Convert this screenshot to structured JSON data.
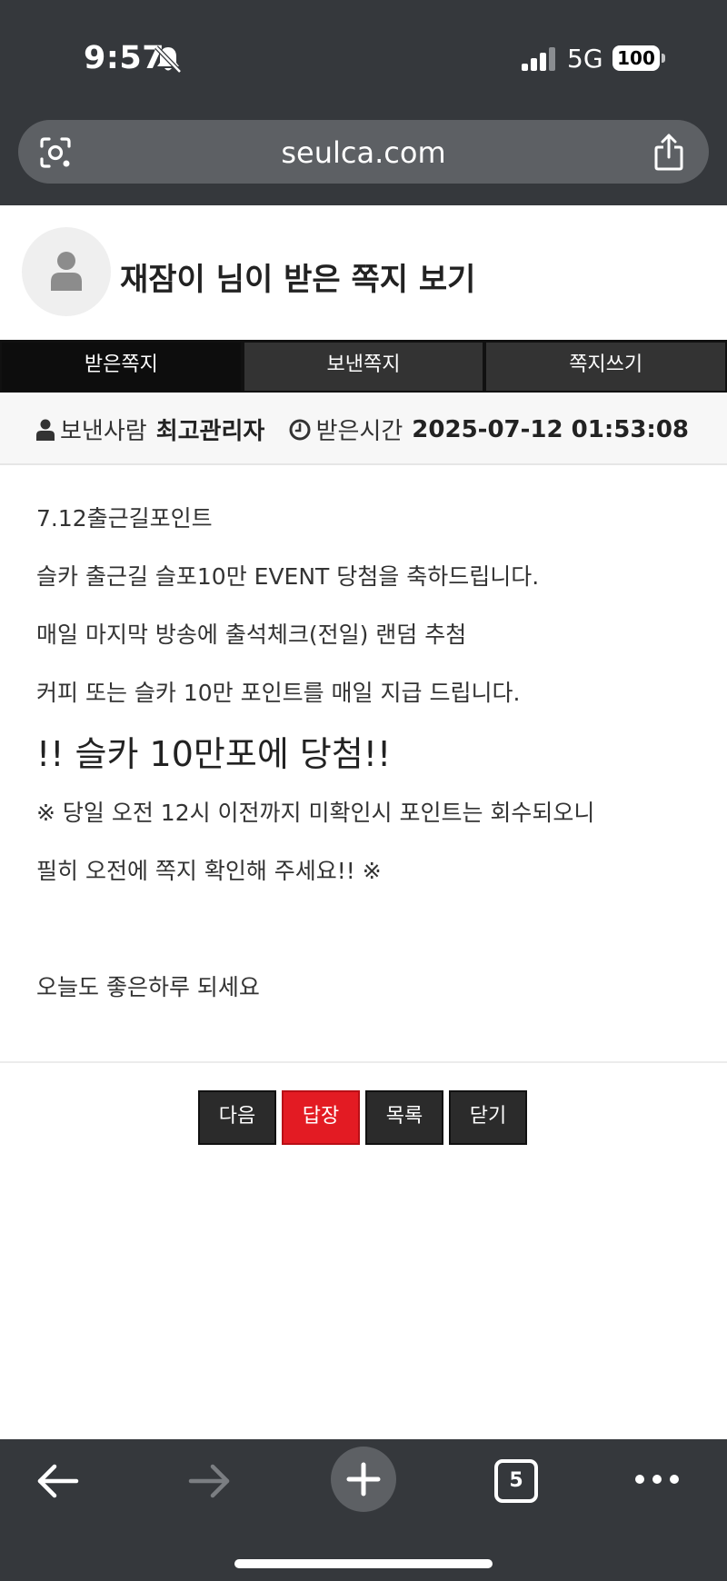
{
  "status_bar": {
    "time": "9:57",
    "network": "5G",
    "battery": "100"
  },
  "browser": {
    "url": "seulca.com",
    "open_tabs": "5"
  },
  "page": {
    "title": "재잠이 님이 받은 쪽지 보기"
  },
  "tabs": [
    {
      "label": "받은쪽지",
      "active": true
    },
    {
      "label": "보낸쪽지",
      "active": false
    },
    {
      "label": "쪽지쓰기",
      "active": false
    }
  ],
  "meta": {
    "sender_label": "보낸사람",
    "sender_value": "최고관리자",
    "time_label": "받은시간",
    "time_value": "2025-07-12 01:53:08"
  },
  "message": {
    "lines": [
      "7.12출근길포인트",
      "슬카 출근길 슬포10만 EVENT 당첨을 축하드립니다.",
      "매일 마지막 방송에 출석체크(전일) 랜덤 추첨",
      "커피 또는 슬카 10만 포인트를 매일 지급 드립니다.",
      "!! 슬카 10만포에 당첨!!",
      "※ 당일 오전 12시 이전까지 미확인시 포인트는 회수되오니",
      "필히 오전에 쪽지 확인해 주세요!! ※",
      "",
      "오늘도 좋은하루 되세요"
    ]
  },
  "actions": {
    "next": "다음",
    "reply": "답장",
    "list": "목록",
    "close": "닫기"
  },
  "colors": {
    "chrome": "#35383c",
    "reply_button": "#e31b23",
    "button_dark": "#2b2b2b",
    "tab_active": "#0d0d0d"
  }
}
